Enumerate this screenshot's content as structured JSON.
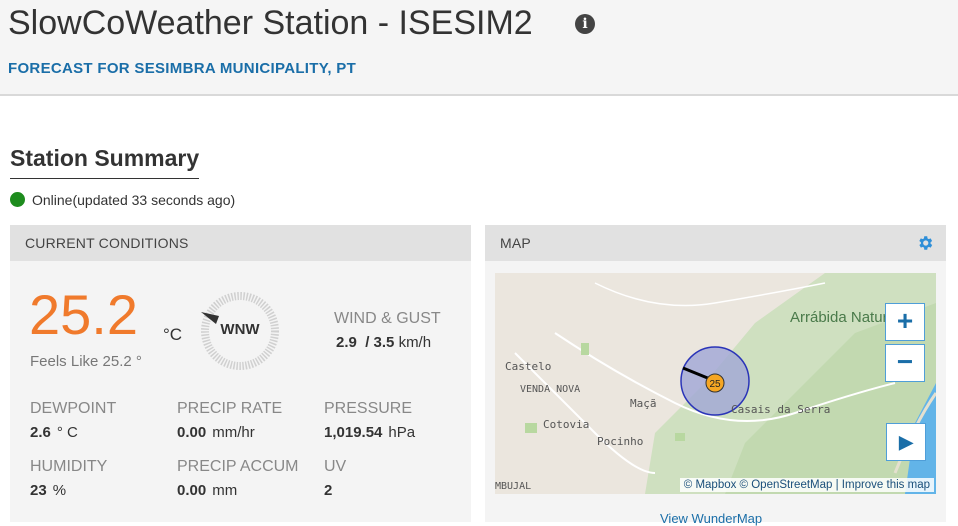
{
  "header": {
    "title": "SlowCoWeather Station - ISESIM2",
    "info_icon": "i",
    "subtitle": "FORECAST FOR SESIMBRA MUNICIPALITY, PT"
  },
  "summary": {
    "title": "Station Summary",
    "status": "Online(updated 33 seconds ago)",
    "status_color": "#1e8c1e"
  },
  "current_conditions": {
    "heading": "CURRENT CONDITIONS",
    "temperature": "25.2",
    "temperature_unit": "°C",
    "feels_like": "Feels Like 25.2 °",
    "wind_direction": "WNW",
    "wind_label": "WIND & GUST",
    "wind_speed": "2.9",
    "gust_speed": "/ 3.5",
    "wind_unit": "km/h",
    "stats": [
      {
        "label": "DEWPOINT",
        "value": "2.6",
        "unit": "° C"
      },
      {
        "label": "PRECIP RATE",
        "value": "0.00",
        "unit": "mm/hr"
      },
      {
        "label": "PRESSURE",
        "value": "1,019.54",
        "unit": "hPa"
      },
      {
        "label": "HUMIDITY",
        "value": "23",
        "unit": "%"
      },
      {
        "label": "PRECIP ACCUM",
        "value": "0.00",
        "unit": "mm"
      },
      {
        "label": "UV",
        "value": "2",
        "unit": ""
      }
    ],
    "accent_color": "#f07a2c"
  },
  "map": {
    "heading": "MAP",
    "gear_icon": "gear-icon",
    "zoom_in": "+",
    "zoom_out": "−",
    "play": "▶",
    "marker_value": "25",
    "labels": {
      "castelo": "Castelo",
      "venda_nova": "VENDA NOVA",
      "maca": "Maçã",
      "cotovia": "Cotovia",
      "pocinho": "Pocinho",
      "casais": "Casais da Serra",
      "mbujal": "MBUJAL",
      "arrabida": "Arrábida Natural P"
    },
    "attribution": "© Mapbox © OpenStreetMap | Improve this map",
    "view_link": "View WunderMap"
  }
}
